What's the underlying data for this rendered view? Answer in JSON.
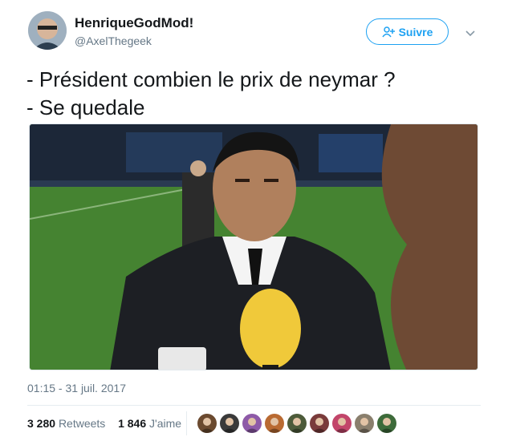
{
  "author": {
    "name": "HenriqueGodMod!",
    "handle": "@AxelThegeek",
    "avatar_icon": "profile-photo-avatar"
  },
  "follow_button": {
    "label": "Suivre",
    "icon": "add-user-icon",
    "color": "#1da1f2"
  },
  "menu_caret": {
    "icon": "chevron-down-icon"
  },
  "tweet": {
    "lines": [
      "- Président combien le prix de neymar ?",
      "- Se quedale"
    ]
  },
  "media": {
    "icon": "photo-interview-stadium"
  },
  "timestamp": "01:15 - 31 juil. 2017",
  "stats": {
    "retweets_count": "3 280",
    "retweets_label": "Retweets",
    "likes_count": "1 846",
    "likes_label": "J'aime"
  },
  "likers": [
    {
      "icon": "liker-avatar-1",
      "color": "#6b4a2f"
    },
    {
      "icon": "liker-avatar-2",
      "color": "#3a3a3a"
    },
    {
      "icon": "liker-avatar-3",
      "color": "#8e5aa8"
    },
    {
      "icon": "liker-avatar-4",
      "color": "#b96a32"
    },
    {
      "icon": "liker-avatar-5",
      "color": "#4d5b3a"
    },
    {
      "icon": "liker-avatar-6",
      "color": "#7a3b3b"
    },
    {
      "icon": "liker-avatar-7",
      "color": "#c2456a"
    },
    {
      "icon": "liker-avatar-8",
      "color": "#8a7f6d"
    },
    {
      "icon": "liker-avatar-9",
      "color": "#3d6b3a"
    }
  ]
}
